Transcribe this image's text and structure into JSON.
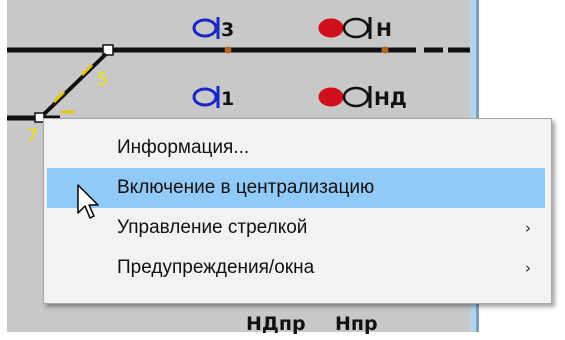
{
  "scheme": {
    "signals": [
      "3",
      "Н",
      "1",
      "НД"
    ],
    "switches": [
      "5",
      "7"
    ],
    "bottom_labels": [
      "НДпр",
      "Нпр"
    ],
    "colors": {
      "background": "#c8c8c8",
      "track": "#111111",
      "signal_outline": "#1a26c8",
      "signal_red": "#d0101a",
      "divider": "#b4d6ec",
      "joint": "#b5651d",
      "switch_number": "#f4e400"
    }
  },
  "context_menu": {
    "items": [
      {
        "label": "Информация...",
        "has_submenu": false,
        "highlighted": false
      },
      {
        "label": "Включение в централизацию",
        "has_submenu": false,
        "highlighted": true
      },
      {
        "label": "Управление стрелкой",
        "has_submenu": true,
        "highlighted": false
      },
      {
        "label": "Предупреждения/окна",
        "has_submenu": true,
        "highlighted": false
      }
    ],
    "submenu_arrow": "›",
    "highlight_color": "#91c9f7"
  },
  "cursor": {
    "icon": "arrow-cursor-icon"
  }
}
